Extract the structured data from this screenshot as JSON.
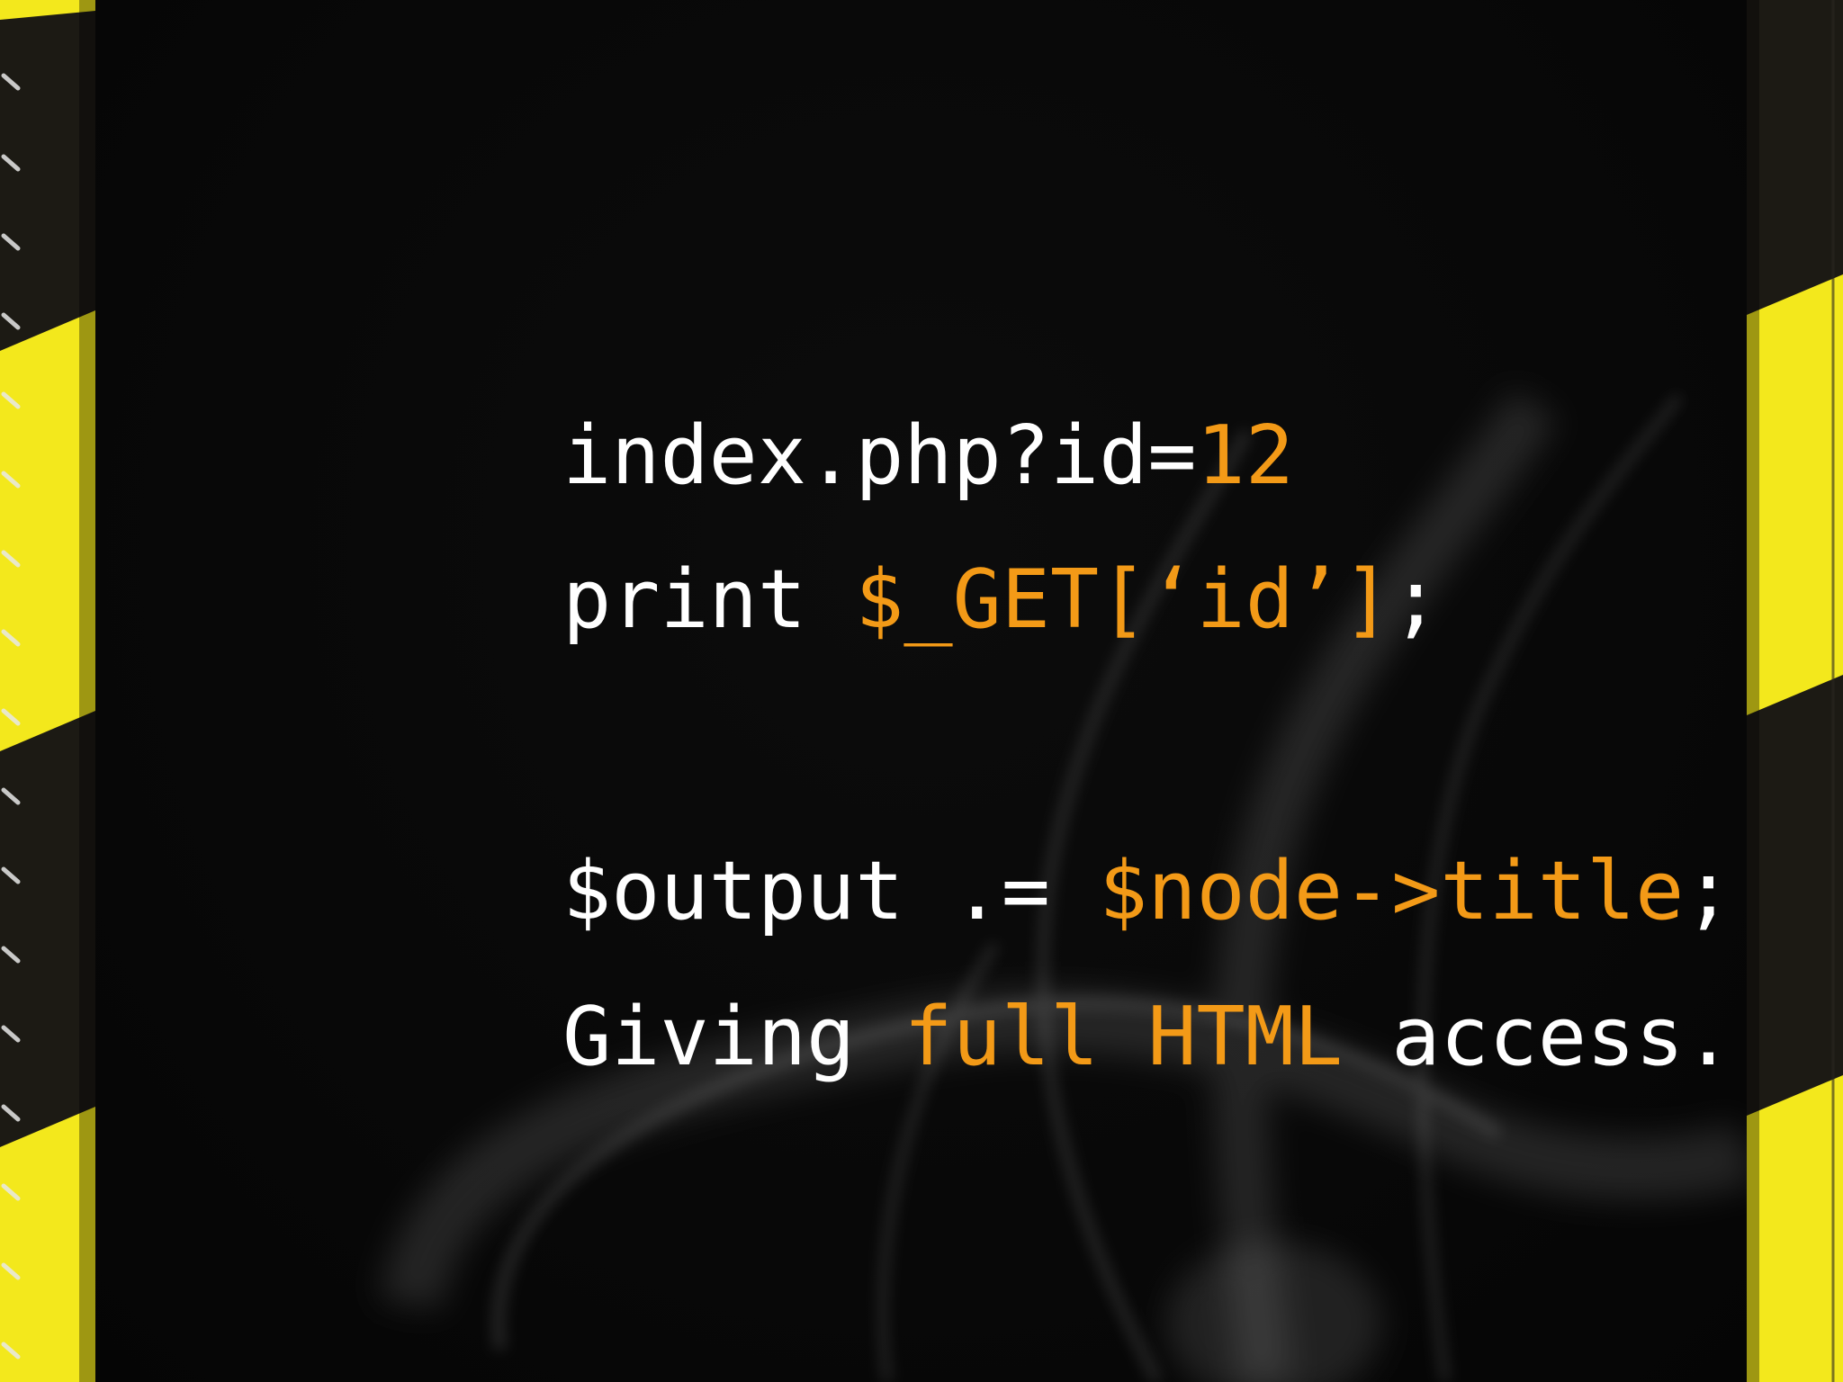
{
  "colors": {
    "background": "#0a0a0a",
    "text": "#ffffff",
    "accent": "#f39a17",
    "stripe_yellow": "#f3e81c",
    "stripe_dark": "#1c1a14"
  },
  "lines": [
    {
      "segments": [
        {
          "text": "index.php?id=",
          "accent": false
        },
        {
          "text": "12",
          "accent": true
        }
      ]
    },
    {
      "segments": [
        {
          "text": "print ",
          "accent": false
        },
        {
          "text": "$_GET[‘id’]",
          "accent": true
        },
        {
          "text": ";",
          "accent": false
        }
      ]
    },
    {
      "segments": [
        {
          "text": "$output .= ",
          "accent": false
        },
        {
          "text": "$node->title",
          "accent": true
        },
        {
          "text": ";",
          "accent": false
        }
      ]
    },
    {
      "segments": [
        {
          "text": "Giving ",
          "accent": false
        },
        {
          "text": "full HTML",
          "accent": true
        },
        {
          "text": " access.",
          "accent": false
        }
      ]
    }
  ]
}
